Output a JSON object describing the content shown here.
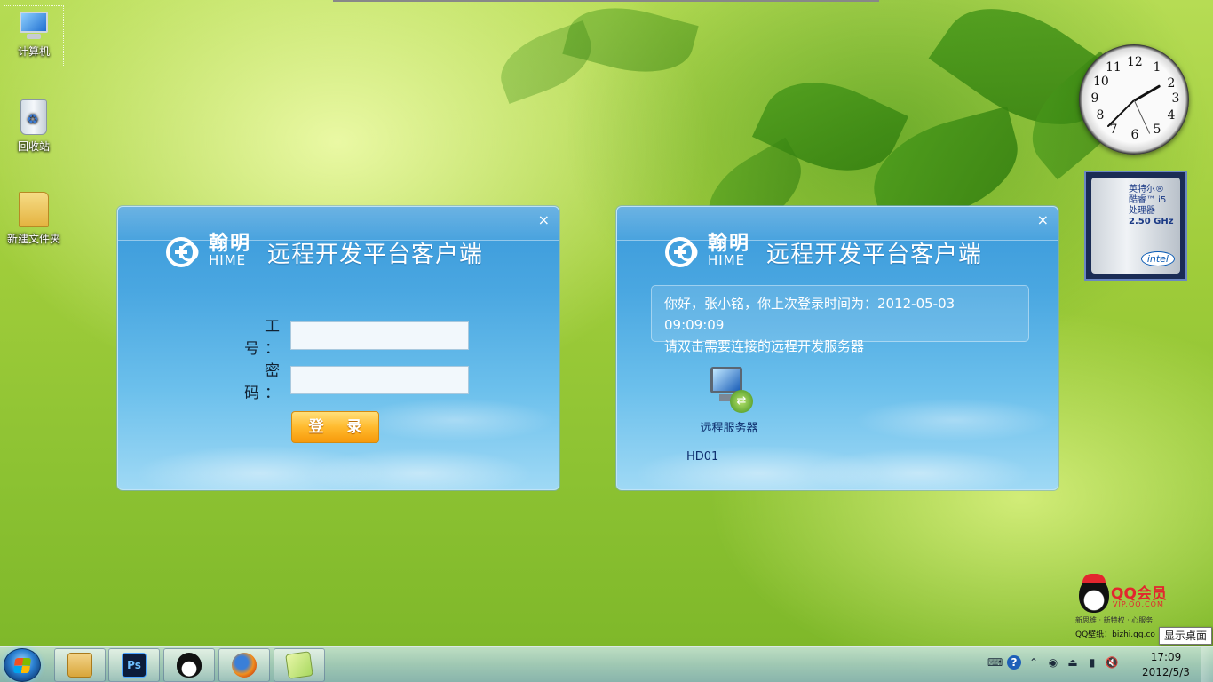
{
  "desktop": {
    "icons": [
      {
        "label": "计算机"
      },
      {
        "label": "回收站"
      },
      {
        "label": "新建文件夹"
      }
    ]
  },
  "gadgets": {
    "clock": {
      "numbers": [
        "12",
        "1",
        "2",
        "3",
        "4",
        "5",
        "6",
        "7",
        "8",
        "9",
        "10",
        "11"
      ],
      "time": "17:09"
    },
    "cpu": {
      "line1": "英特尔®",
      "line2": "酷睿™ i5",
      "line3": "处理器",
      "line4": "2.50 GHz",
      "brand": "intel"
    }
  },
  "login_dialog": {
    "logo_cn": "翰明",
    "logo_en": "HIME",
    "title": "远程开发平台客户端",
    "close": "×",
    "id_label": "工 号：",
    "password_label": "密 码：",
    "id_value": "",
    "password_value": "",
    "login_button": "登 录"
  },
  "server_dialog": {
    "logo_cn": "翰明",
    "logo_en": "HIME",
    "title": "远程开发平台客户端",
    "close": "×",
    "greeting": "你好，张小铭，你上次登录时间为：2012-05-03 09:09:09",
    "instruction": "请双击需要连接的远程开发服务器",
    "server_label": "远程服务器",
    "server_id": "HD01"
  },
  "qq_ad": {
    "title": "QQ会员",
    "url": "VIP.QQ.COM",
    "slogan": "新思维 · 新特权 · 心服务",
    "wallpaper": "QQ壁纸：bizhi.qq.co"
  },
  "tooltip": {
    "show_desktop": "显示桌面"
  },
  "taskbar": {
    "pinned": [
      {
        "name": "windows-explorer",
        "label": ""
      },
      {
        "name": "photoshop",
        "label": "Ps"
      },
      {
        "name": "qq",
        "label": ""
      },
      {
        "name": "firefox",
        "label": ""
      },
      {
        "name": "sticky-notes",
        "label": ""
      }
    ],
    "tray": {
      "keyboard": "⌨",
      "help": "?",
      "arrow": "⌃",
      "qq": "◉",
      "usb": "⏏",
      "signal": "▮",
      "volume": "🔇"
    },
    "time": "17:09",
    "date": "2012/5/3"
  }
}
